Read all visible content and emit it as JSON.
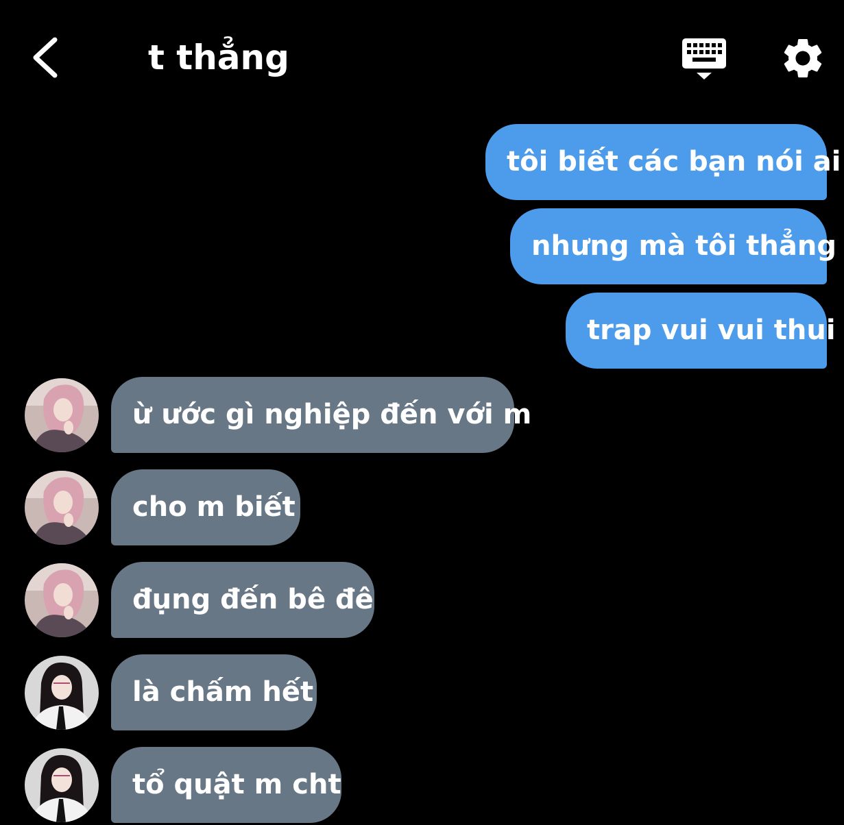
{
  "header": {
    "back_icon": "chevron-left-icon",
    "title": "t thẳng",
    "keyboard_icon": "keyboard-hide-icon",
    "settings_icon": "gear-icon"
  },
  "colors": {
    "background": "#000000",
    "outgoing_bubble": "#4c9ceb",
    "incoming_bubble": "#687785",
    "text": "#ffffff"
  },
  "messages": [
    {
      "direction": "outgoing",
      "text": "tôi biết các bạn nói ai"
    },
    {
      "direction": "outgoing",
      "text": "nhưng mà tôi thẳng"
    },
    {
      "direction": "outgoing",
      "text": "trap vui vui thui"
    },
    {
      "direction": "incoming",
      "avatar": "avatar-pink-hair",
      "text": "ừ ước gì nghiệp đến với m"
    },
    {
      "direction": "incoming",
      "avatar": "avatar-pink-hair",
      "text": "cho m biết"
    },
    {
      "direction": "incoming",
      "avatar": "avatar-pink-hair",
      "text": "đụng đến bê đê"
    },
    {
      "direction": "incoming",
      "avatar": "avatar-dark-hair-glasses",
      "text": "là chấm hết"
    },
    {
      "direction": "incoming",
      "avatar": "avatar-dark-hair-glasses",
      "text": "tổ quật m cht"
    }
  ]
}
